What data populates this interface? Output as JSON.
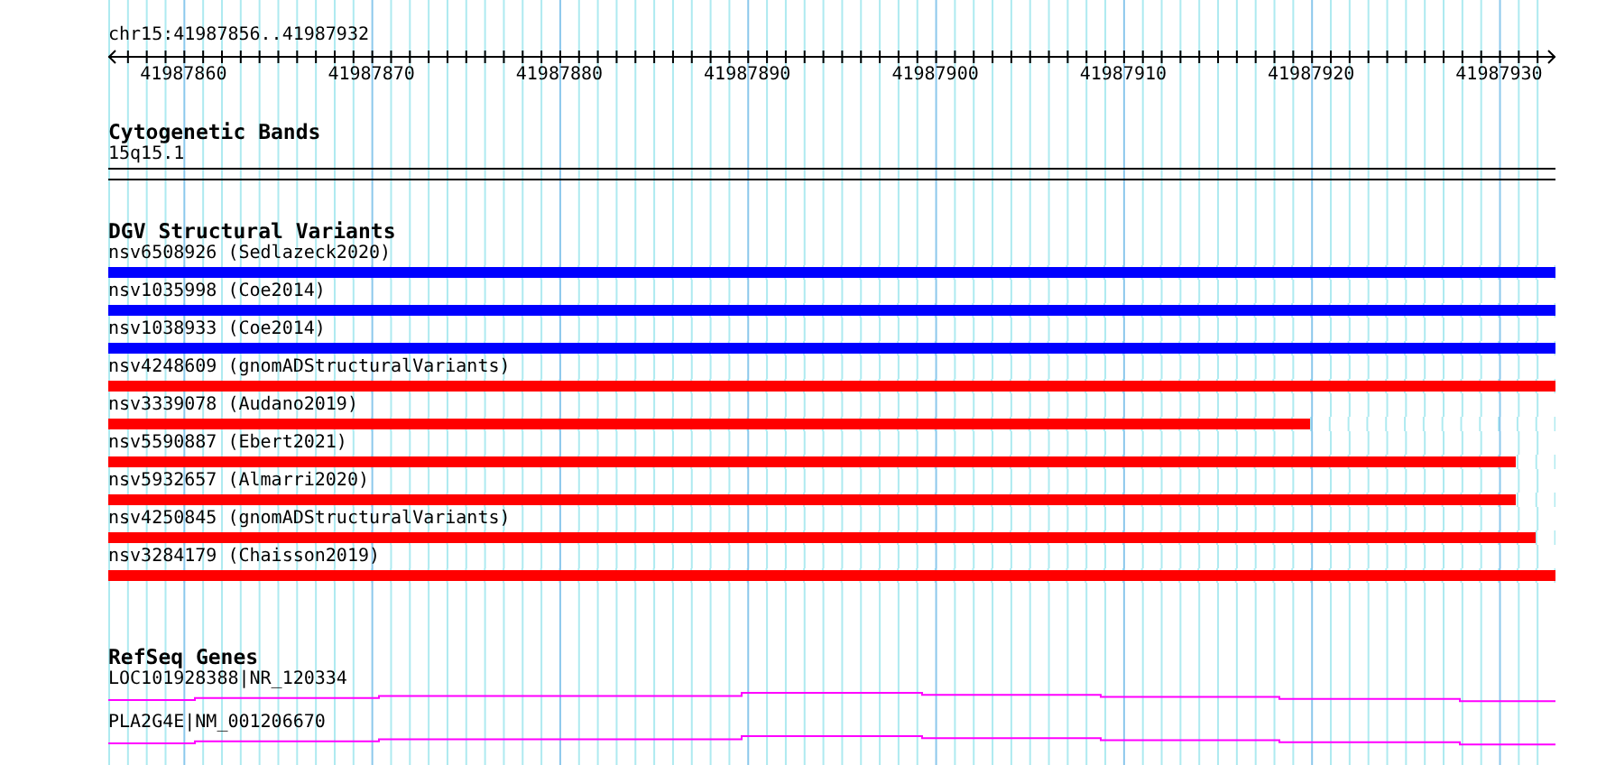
{
  "ruler": {
    "location": "chr15:41987856..41987932",
    "labels": [
      "41987860",
      "41987870",
      "41987880",
      "41987890",
      "41987900",
      "41987910",
      "41987920",
      "41987930"
    ]
  },
  "cytogenetic_bands": {
    "title": "Cytogenetic Bands",
    "band": "15q15.1"
  },
  "dgv_structural_variants": {
    "title": "DGV Structural Variants",
    "variants": [
      {
        "label": "nsv6508926 (Sedlazeck2020)",
        "color": "#0000ff",
        "level": 1
      },
      {
        "label": "nsv1035998 (Coe2014)",
        "color": "#0000ff",
        "level": 1
      },
      {
        "label": "nsv1038933 (Coe2014)",
        "color": "#0000ff",
        "level": 1
      },
      {
        "label": "nsv4248609 (gnomADStructuralVariants)",
        "color": "#ff0000",
        "level": 1
      },
      {
        "label": "nsv3339078 (Audano2019)",
        "color": "#ff0000",
        "level": 0.83
      },
      {
        "label": "nsv5590887 (Ebert2021)",
        "color": "#ff0000",
        "level": 0.973
      },
      {
        "label": "nsv5932657 (Almarri2020)",
        "color": "#ff0000",
        "level": 0.973
      },
      {
        "label": "nsv4250845 (gnomADStructuralVariants)",
        "color": "#ff0000",
        "level": 0.986
      },
      {
        "label": "nsv3284179 (Chaisson2019)",
        "color": "#ff0000",
        "level": 1
      }
    ]
  },
  "refseq_genes": {
    "title": "RefSeq Genes",
    "genes": [
      {
        "label": "LOC101928388|NR_120334"
      },
      {
        "label": "PLA2G4E|NM_001206670"
      }
    ]
  }
}
